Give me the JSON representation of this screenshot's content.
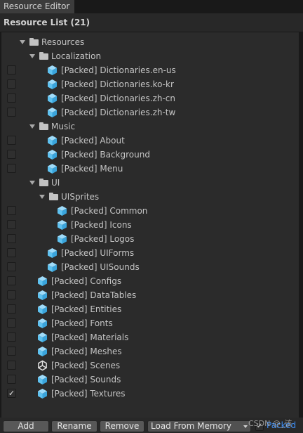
{
  "window": {
    "tab_title": "Resource Editor",
    "list_header": "Resource List (21)"
  },
  "tree": {
    "rows": [
      {
        "label": "Resources",
        "kind": "folder"
      },
      {
        "label": "Localization",
        "kind": "folder"
      },
      {
        "label": "[Packed] Dictionaries.en-us",
        "kind": "asset",
        "checked": false
      },
      {
        "label": "[Packed] Dictionaries.ko-kr",
        "kind": "asset",
        "checked": false
      },
      {
        "label": "[Packed] Dictionaries.zh-cn",
        "kind": "asset",
        "checked": false
      },
      {
        "label": "[Packed] Dictionaries.zh-tw",
        "kind": "asset",
        "checked": false
      },
      {
        "label": "Music",
        "kind": "folder"
      },
      {
        "label": "[Packed] About",
        "kind": "asset",
        "checked": false
      },
      {
        "label": "[Packed] Background",
        "kind": "asset",
        "checked": false
      },
      {
        "label": "[Packed] Menu",
        "kind": "asset",
        "checked": false
      },
      {
        "label": "UI",
        "kind": "folder"
      },
      {
        "label": "UISprites",
        "kind": "folder"
      },
      {
        "label": "[Packed] Common",
        "kind": "asset",
        "checked": false
      },
      {
        "label": "[Packed] Icons",
        "kind": "asset",
        "checked": false
      },
      {
        "label": "[Packed] Logos",
        "kind": "asset",
        "checked": false
      },
      {
        "label": "[Packed] UIForms",
        "kind": "asset",
        "checked": false
      },
      {
        "label": "[Packed] UISounds",
        "kind": "asset",
        "checked": false
      },
      {
        "label": "[Packed] Configs",
        "kind": "asset",
        "checked": false
      },
      {
        "label": "[Packed] DataTables",
        "kind": "asset",
        "checked": false
      },
      {
        "label": "[Packed] Entities",
        "kind": "asset",
        "checked": false
      },
      {
        "label": "[Packed] Fonts",
        "kind": "asset",
        "checked": false
      },
      {
        "label": "[Packed] Materials",
        "kind": "asset",
        "checked": false
      },
      {
        "label": "[Packed] Meshes",
        "kind": "asset",
        "checked": false
      },
      {
        "label": "[Packed] Scenes",
        "kind": "scene",
        "checked": false
      },
      {
        "label": "[Packed] Sounds",
        "kind": "asset",
        "checked": false
      },
      {
        "label": "[Packed] Textures",
        "kind": "asset",
        "checked": true
      }
    ]
  },
  "footer": {
    "add_label": "Add",
    "rename_label": "Rename",
    "remove_label": "Remove",
    "load_type_value": "Load From Memory",
    "packed_label": "Packed",
    "packed_checked": true
  },
  "watermark": "CSDN @_该",
  "colors": {
    "cube": "#5fc2f0",
    "packed_label": "#3e8ef5"
  },
  "icons": {
    "folder": "folder-icon",
    "asset": "prefab-cube-icon",
    "scene": "unity-scene-icon"
  }
}
